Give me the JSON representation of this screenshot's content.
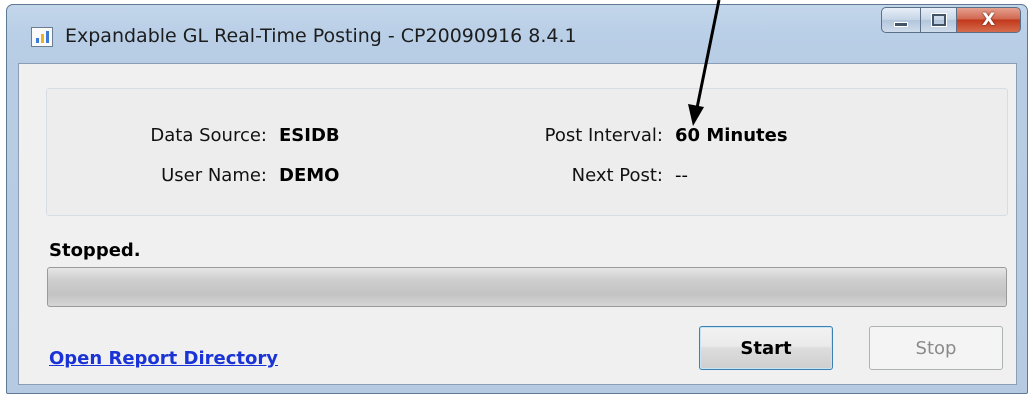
{
  "window": {
    "title": "Expandable GL Real-Time Posting - CP20090916 8.4.1",
    "close_glyph": "X"
  },
  "info": {
    "data_source_label": "Data Source:",
    "data_source_value": "ESIDB",
    "user_name_label": "User Name:",
    "user_name_value": "DEMO",
    "post_interval_label": "Post Interval:",
    "post_interval_value": "60 Minutes",
    "next_post_label": "Next Post:",
    "next_post_value": "--"
  },
  "status": {
    "text": "Stopped.",
    "progress": 0
  },
  "footer": {
    "link_label": "Open Report Directory",
    "start_label": "Start",
    "stop_label": "Stop"
  },
  "colors": {
    "link": "#1a33d6",
    "close_button": "#c2381b",
    "window_frame": "#b9cfe7"
  },
  "icons": {
    "app": "bar-chart-icon",
    "minimize": "minimize-icon",
    "maximize": "maximize-icon",
    "close": "close-icon",
    "annotation": "arrow-annotation"
  }
}
